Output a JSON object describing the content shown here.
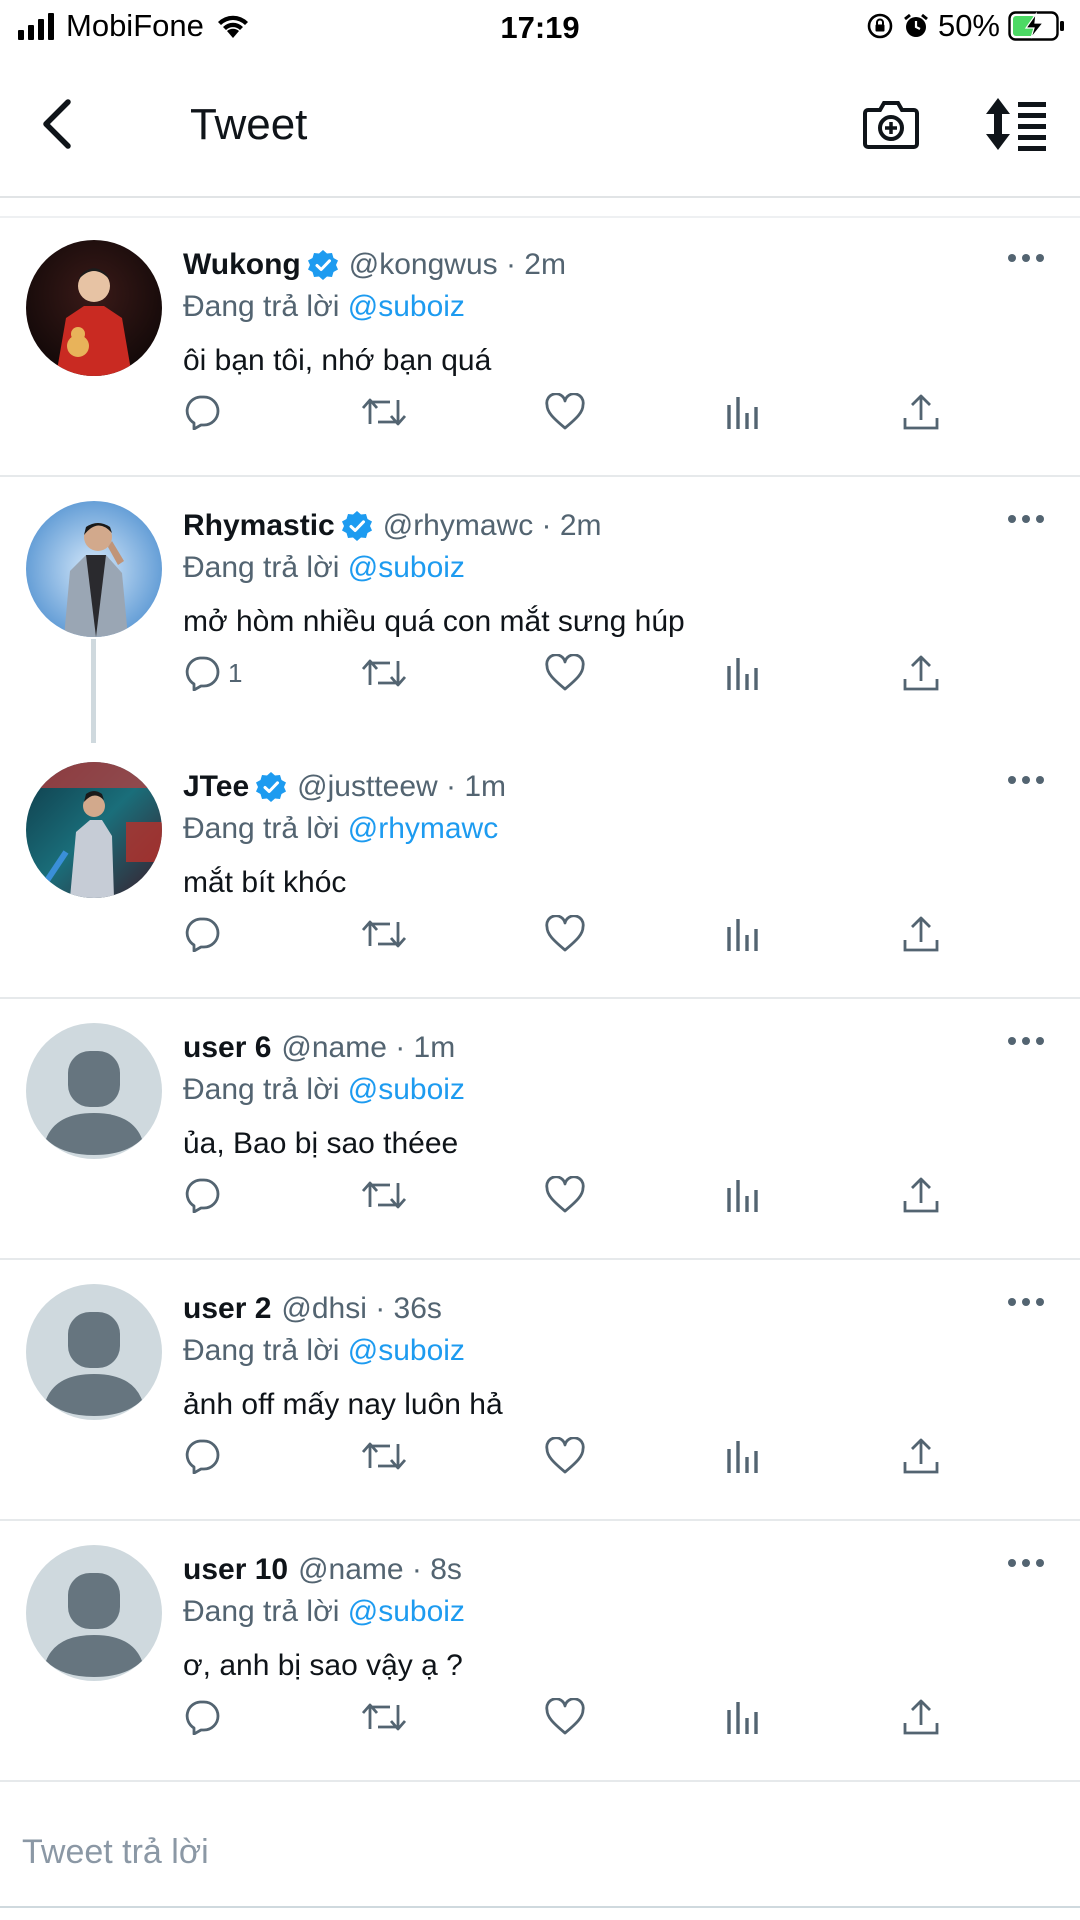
{
  "status_bar": {
    "carrier": "MobiFone",
    "time": "17:19",
    "battery": "50%"
  },
  "nav": {
    "title": "Tweet",
    "back_icon": "chevron-left-icon",
    "camera_icon": "camera-plus-icon",
    "sort_icon": "sort-icon"
  },
  "colors": {
    "accent": "#1d9bf0",
    "secondary_text": "#536471",
    "divider": "#e6e9eb",
    "battery_green": "#4cd964"
  },
  "tweets": [
    {
      "name": "Wukong",
      "verified": true,
      "handle": "@kongwus · 2m",
      "reply_prefix": "Đang trả lời ",
      "reply_to": "@suboiz",
      "text": "ôi bạn tôi, nhớ bạn quá",
      "reply_count": "",
      "avatar": "photo"
    },
    {
      "name": "Rhymastic",
      "verified": true,
      "handle": "@rhymawc · 2m",
      "reply_prefix": "Đang trả lời ",
      "reply_to": "@suboiz",
      "text": "mở hòm nhiều quá con mắt sưng húp",
      "reply_count": "1",
      "avatar": "photo"
    },
    {
      "name": "JTee",
      "verified": true,
      "handle": "@justteew · 1m",
      "reply_prefix": "Đang trả lời ",
      "reply_to": "@rhymawc",
      "text": "mắt bít khóc",
      "reply_count": "",
      "avatar": "photo"
    },
    {
      "name": "user 6",
      "verified": false,
      "handle": "@name · 1m",
      "reply_prefix": "Đang trả lời ",
      "reply_to": "@suboiz",
      "text": "ủa, Bao bị sao théee",
      "reply_count": "",
      "avatar": "default"
    },
    {
      "name": "user 2",
      "verified": false,
      "handle": "@dhsi · 36s",
      "reply_prefix": "Đang trả lời ",
      "reply_to": "@suboiz",
      "text": "ảnh off mấy nay luôn hả",
      "reply_count": "",
      "avatar": "default"
    },
    {
      "name": "user 10",
      "verified": false,
      "handle": "@name · 8s",
      "reply_prefix": "Đang trả lời ",
      "reply_to": "@suboiz",
      "text": "ơ, anh bị sao vậy ạ ?",
      "reply_count": "",
      "avatar": "default"
    }
  ],
  "actions": [
    "reply-icon",
    "retweet-icon",
    "like-icon",
    "analytics-icon",
    "share-icon"
  ],
  "reply_bar": {
    "placeholder": "Tweet trả lời"
  }
}
